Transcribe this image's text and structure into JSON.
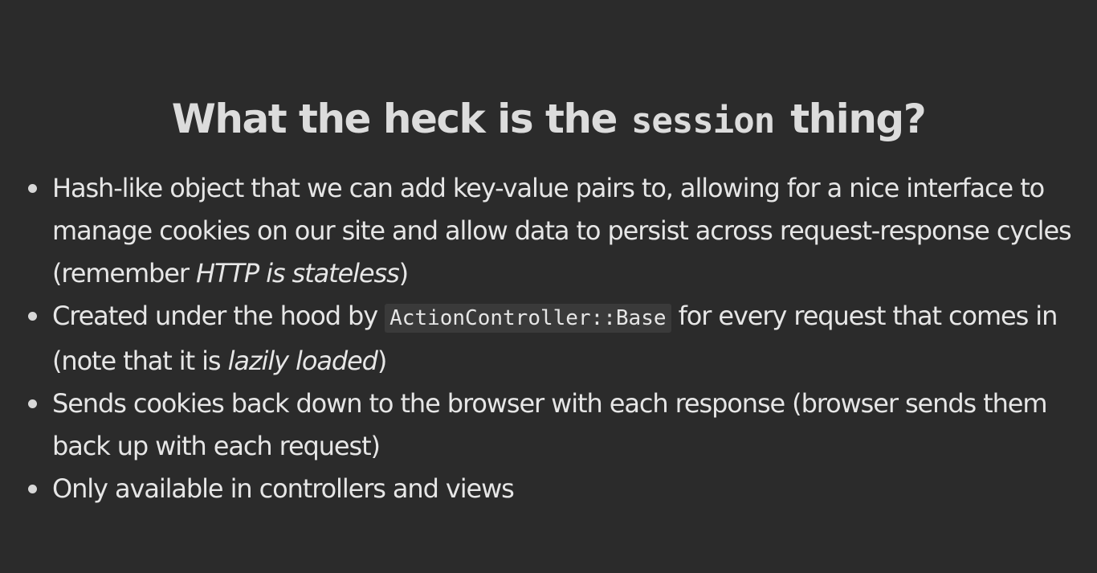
{
  "title": {
    "prefix": "What the heck is the",
    "code": "session",
    "suffix": "thing?"
  },
  "bullets": [
    {
      "text_1": "Hash-like object that we can add key-value pairs to, allowing for a nice interface to manage cookies on our site and allow data to persist across request-response cycles (remember ",
      "em": "HTTP is stateless",
      "text_2": ")"
    },
    {
      "text_1": "Created under the hood by ",
      "code": "ActionController::Base",
      "text_2": " for every request that comes in (note that it is ",
      "em": "lazily loaded",
      "text_3": ")"
    },
    {
      "text": "Sends cookies back down to the browser with each response (browser sends them back up with each request)"
    },
    {
      "text": "Only available in controllers and views"
    }
  ]
}
